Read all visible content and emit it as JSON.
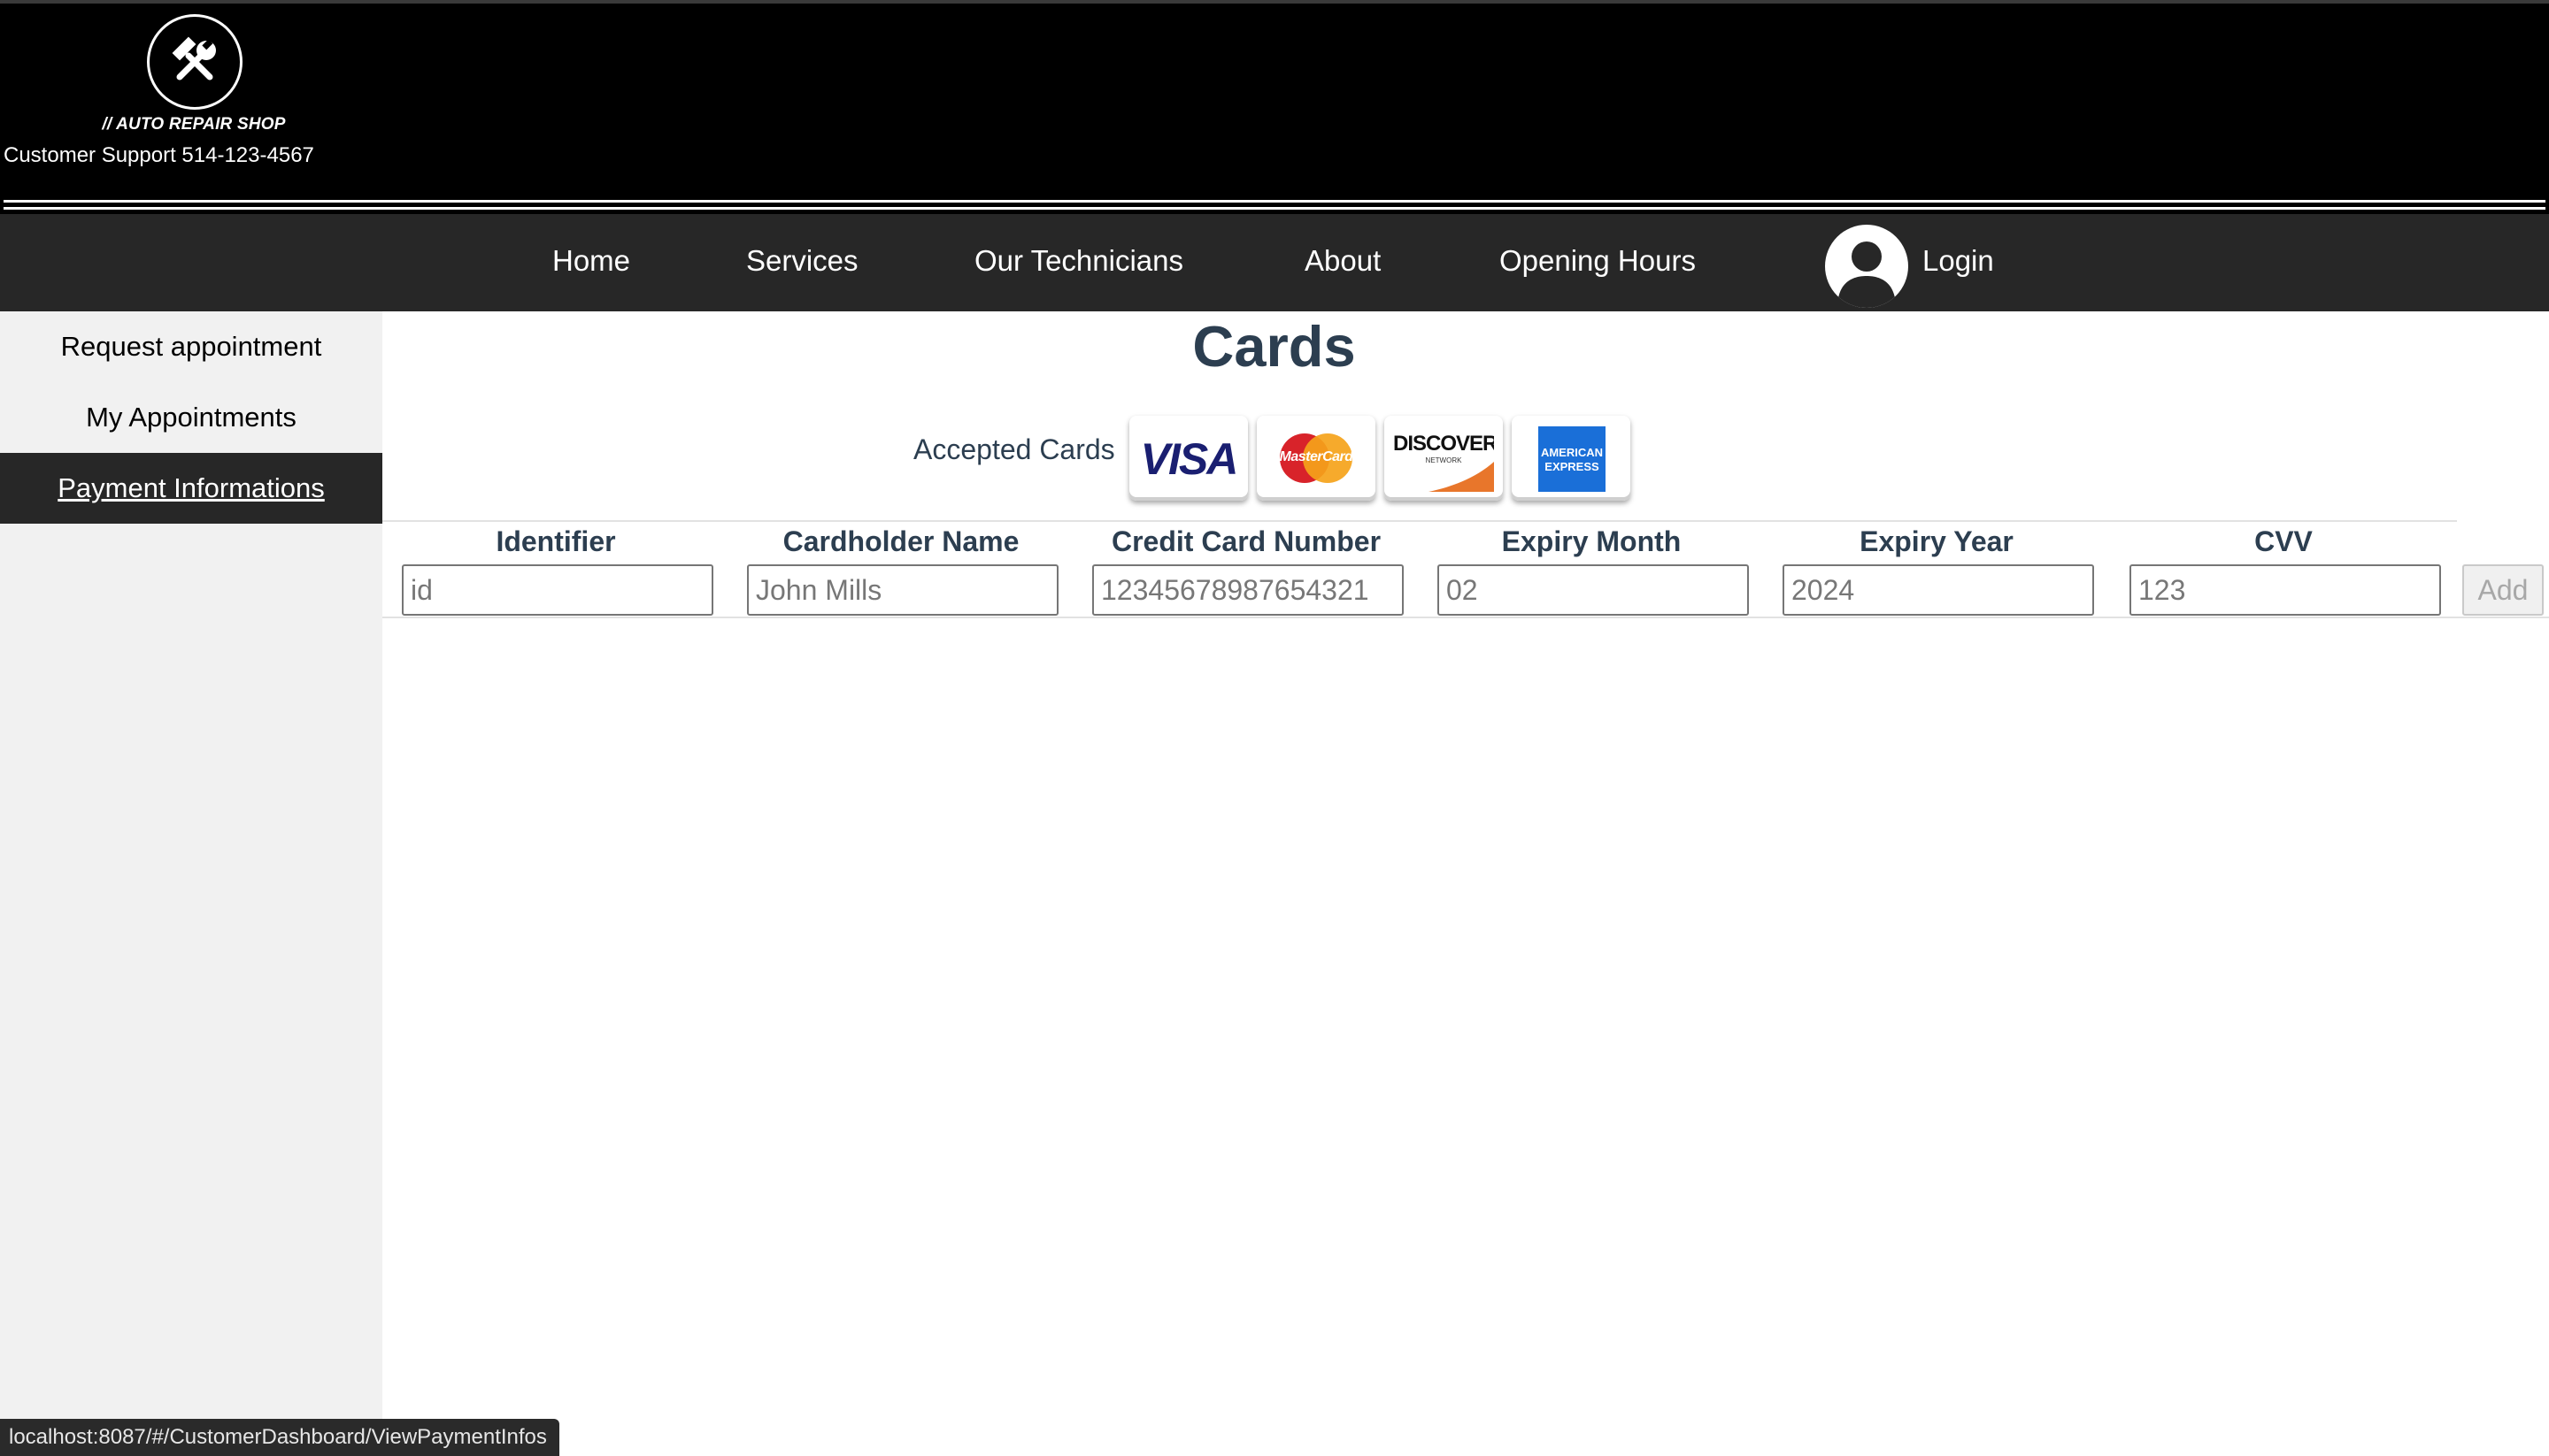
{
  "header": {
    "logo_text": "// AUTO REPAIR SHOP",
    "support_text": "Customer Support 514-123-4567"
  },
  "nav": {
    "items": [
      "Home",
      "Services",
      "Our Technicians",
      "About",
      "Opening Hours"
    ],
    "login_label": "Login"
  },
  "sidebar": {
    "items": [
      {
        "label": "Request appointment",
        "active": false
      },
      {
        "label": "My Appointments",
        "active": false
      },
      {
        "label": "Payment Informations",
        "active": true
      }
    ]
  },
  "main": {
    "title": "Cards",
    "accepted_label": "Accepted Cards",
    "cards": [
      {
        "name": "visa-card-logo",
        "text": "VISA"
      },
      {
        "name": "mastercard-card-logo",
        "text": "MasterCard"
      },
      {
        "name": "discover-card-logo",
        "text": "DISCOVER",
        "sub": "NETWORK"
      },
      {
        "name": "amex-card-logo",
        "text": "AMERICAN EXPRESS"
      }
    ],
    "columns": [
      "Identifier",
      "Cardholder Name",
      "Credit Card Number",
      "Expiry Month",
      "Expiry Year",
      "CVV"
    ],
    "placeholders": {
      "identifier": "id",
      "cardholder": "John Mills",
      "number": "12345678987654321",
      "month": "02",
      "year": "2024",
      "cvv": "123"
    },
    "add_label": "Add"
  },
  "status_bar": {
    "url": "localhost:8087/#/CustomerDashboard/ViewPaymentInfos"
  }
}
